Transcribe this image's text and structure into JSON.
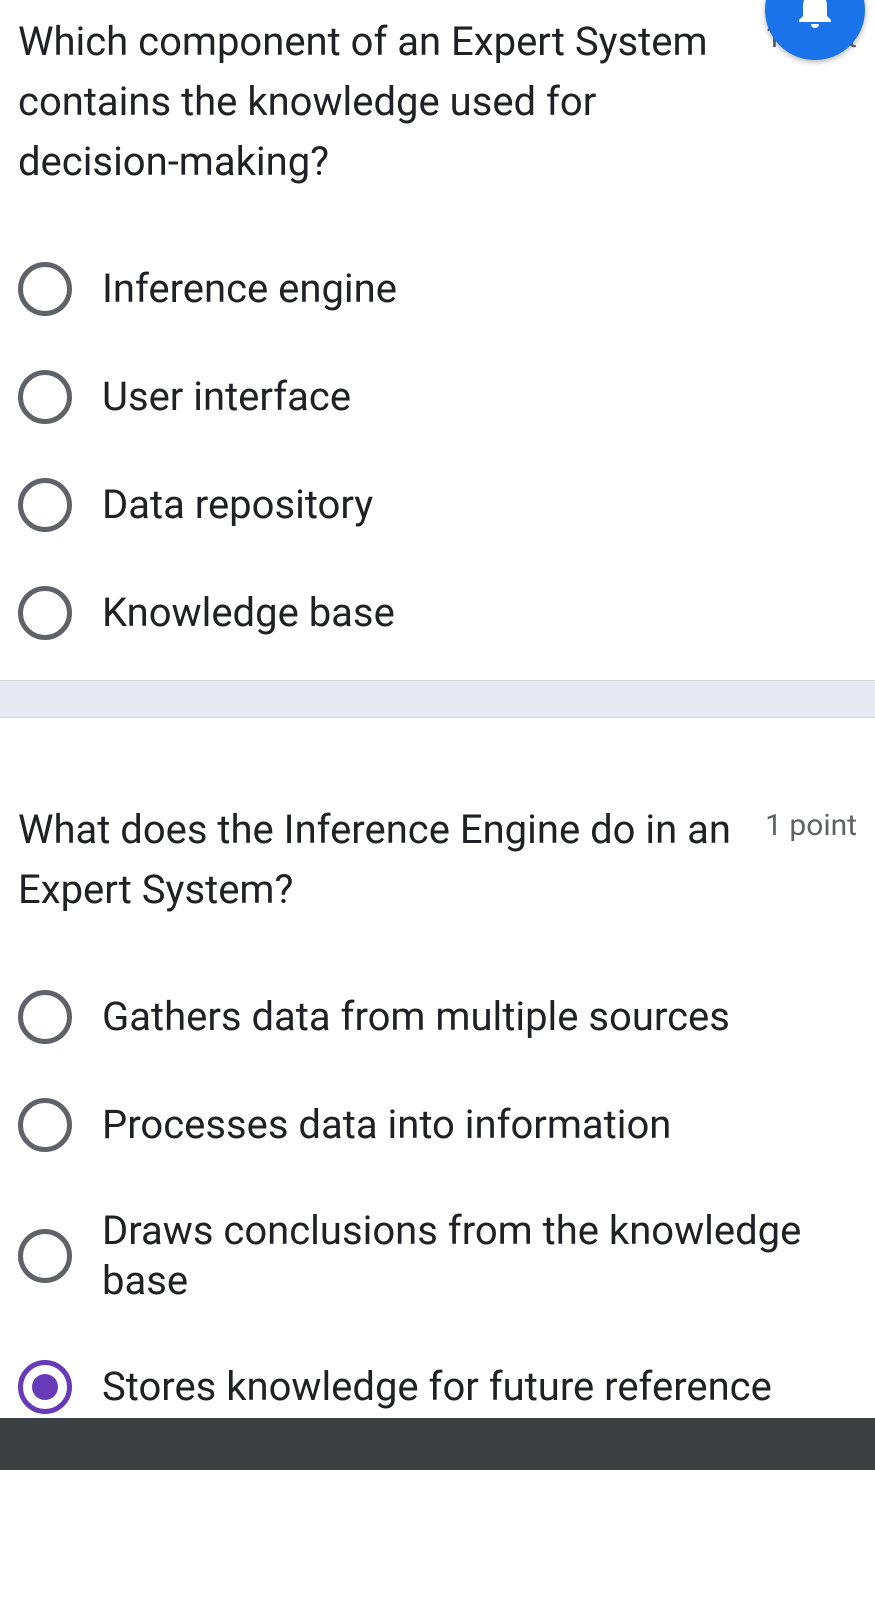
{
  "fabIcon": "bell-icon",
  "questions": [
    {
      "text": "Which component of an Expert System contains the knowledge used for decision-making?",
      "points": "1 point",
      "options": [
        {
          "label": "Inference engine",
          "selected": false
        },
        {
          "label": "User interface",
          "selected": false
        },
        {
          "label": "Data repository",
          "selected": false
        },
        {
          "label": "Knowledge base",
          "selected": false
        }
      ]
    },
    {
      "text": "What does the Inference Engine do in an Expert System?",
      "points": "1 point",
      "options": [
        {
          "label": "Gathers data from multiple sources",
          "selected": false
        },
        {
          "label": "Processes data into information",
          "selected": false
        },
        {
          "label": "Draws conclusions from the knowledge base",
          "selected": false
        },
        {
          "label": "Stores knowledge for future reference",
          "selected": true
        }
      ]
    }
  ]
}
